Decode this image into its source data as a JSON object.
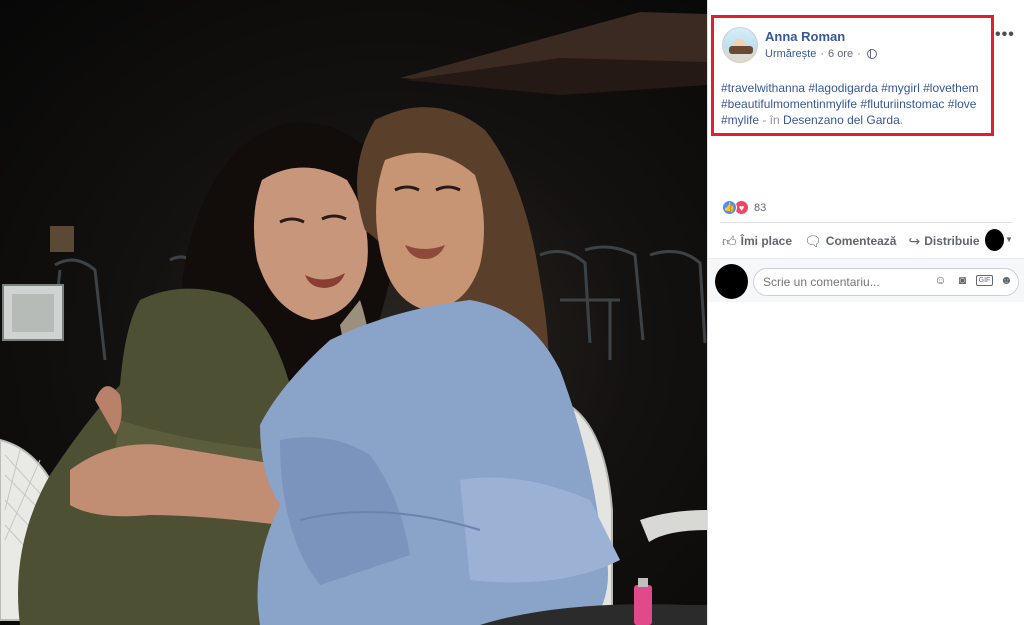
{
  "post": {
    "author": "Anna Roman",
    "follow": "Urmărește",
    "dot": "·",
    "time": "6 ore",
    "text_lines": [
      "#travelwithanna #lagodigarda #mygirl #lovethem",
      "#beautifulmomentinmylife #fluturiinstomac #love"
    ],
    "last_tag": "#mylife",
    "location_sep": " - în ",
    "location": "Desenzano del Garda",
    "location_end": "."
  },
  "reactions": {
    "like_icon": "👍",
    "love_icon": "♥",
    "count": "83"
  },
  "actions": {
    "like_label": "Îmi place",
    "comment_label": "Comentează",
    "share_label": "Distribuie"
  },
  "comment": {
    "placeholder": "Scrie un comentariu..."
  },
  "colors": {
    "link": "#365899",
    "highlight": "#e0202a"
  }
}
